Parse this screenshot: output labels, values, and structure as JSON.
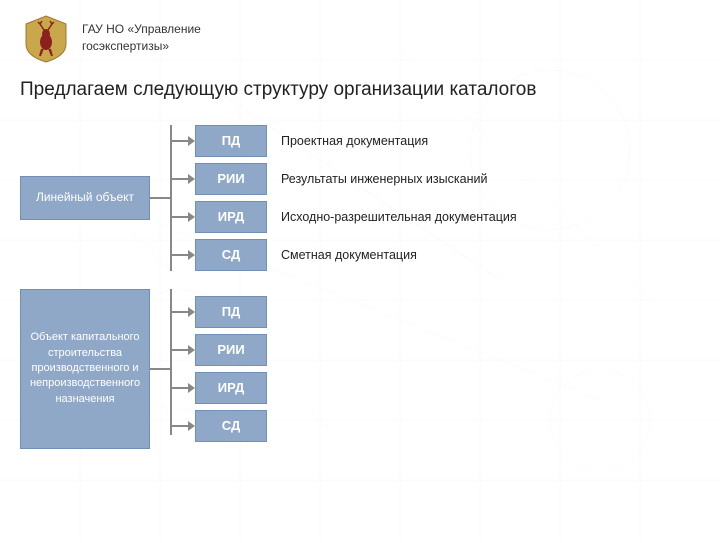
{
  "header": {
    "org_line1": "ГАУ НО «Управление",
    "org_line2": "госэкспертизы»"
  },
  "title": "Предлагаем следующую структуру организации каталогов",
  "section1": {
    "left_box": "Линейный объект",
    "items": [
      {
        "code": "ПД",
        "desc": "Проектная документация"
      },
      {
        "code": "РИИ",
        "desc": "Результаты инженерных изысканий"
      },
      {
        "code": "ИРД",
        "desc": "Исходно-разрешительная документация"
      },
      {
        "code": "СД",
        "desc": "Сметная документация"
      }
    ]
  },
  "section2": {
    "left_box": "Объект капитального строительства производственного и непроизводственного назначения",
    "items": [
      {
        "code": "ПД",
        "desc": ""
      },
      {
        "code": "РИИ",
        "desc": ""
      },
      {
        "code": "ИРД",
        "desc": ""
      },
      {
        "code": "СД",
        "desc": ""
      }
    ]
  },
  "colors": {
    "box_bg": "#8fa8c8",
    "box_border": "#7090b8",
    "arrow": "#888888",
    "text_desc": "#222222"
  }
}
